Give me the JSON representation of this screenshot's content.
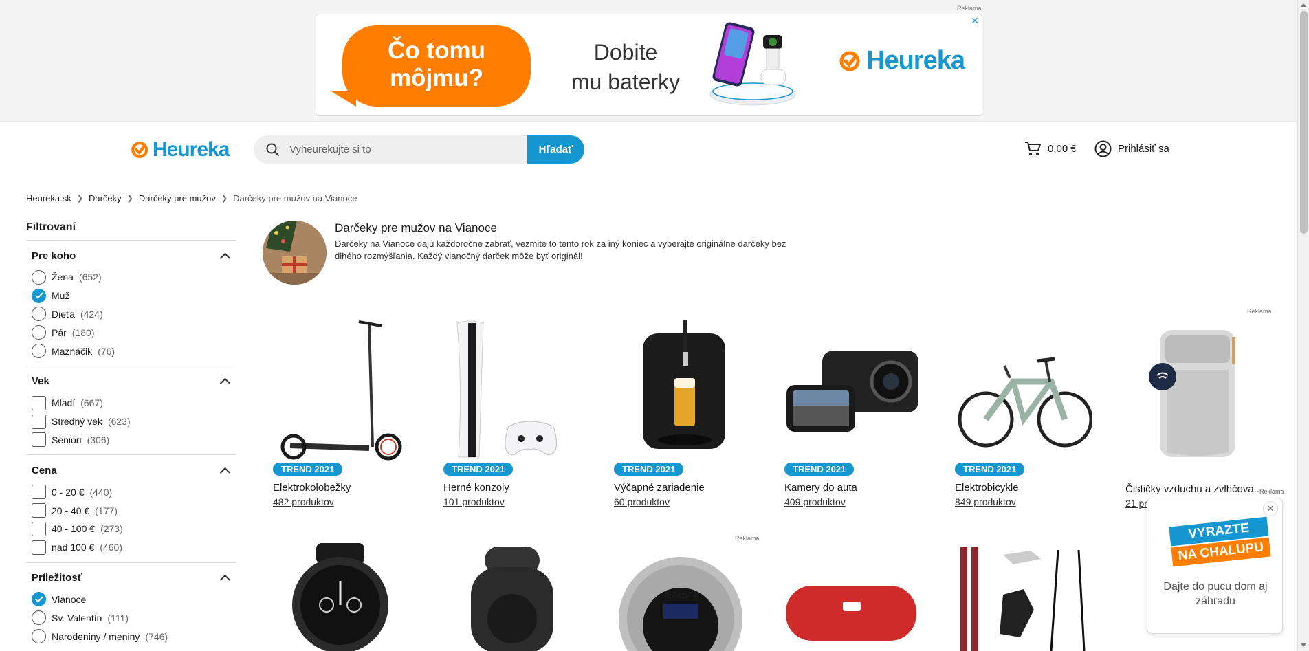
{
  "ad_banner": {
    "label": "Reklama",
    "bubble_line1": "Čo tomu",
    "bubble_line2": "môjmu?",
    "text_line1": "Dobite",
    "text_line2": "mu baterky",
    "brand": "Heureka",
    "close": "✕"
  },
  "header": {
    "logo": "Heureka",
    "search_placeholder": "Vyheurekujte si to",
    "search_button": "Hľadať",
    "cart_amount": "0,00 €",
    "login": "Prihlásiť sa"
  },
  "breadcrumb": [
    "Heureka.sk",
    "Darčeky",
    "Darčeky pre mužov",
    "Darčeky pre mužov na Vianoce"
  ],
  "sidebar": {
    "title": "Filtrovaní",
    "groups": [
      {
        "title": "Pre koho",
        "options": [
          {
            "label": "Žena",
            "count": "(652)",
            "checked": false
          },
          {
            "label": "Muž",
            "count": "",
            "checked": true
          },
          {
            "label": "Dieťa",
            "count": "(424)",
            "checked": false
          },
          {
            "label": "Pár",
            "count": "(180)",
            "checked": false
          },
          {
            "label": "Maznáčik",
            "count": "(76)",
            "checked": false
          }
        ]
      },
      {
        "title": "Vek",
        "options": [
          {
            "label": "Mladí",
            "count": "(667)"
          },
          {
            "label": "Stredný vek",
            "count": "(623)"
          },
          {
            "label": "Seniori",
            "count": "(306)"
          }
        ]
      },
      {
        "title": "Cena",
        "options": [
          {
            "label": "0 - 20 €",
            "count": "(440)"
          },
          {
            "label": "20 - 40 €",
            "count": "(177)"
          },
          {
            "label": "40 - 100 €",
            "count": "(273)"
          },
          {
            "label": "nad 100 €",
            "count": "(460)"
          }
        ]
      },
      {
        "title": "Príležitosť",
        "options": [
          {
            "label": "Vianoce",
            "count": "",
            "checked": true
          },
          {
            "label": "Sv. Valentín",
            "count": "(111)",
            "checked": false
          },
          {
            "label": "Narodeniny / meniny",
            "count": "(746)",
            "checked": false
          }
        ]
      }
    ]
  },
  "intro": {
    "title": "Darčeky pre mužov na Vianoce",
    "description": "Darčeky na Vianoce dajú každoročne zabrať, vezmite to tento rok za iný koniec a vyberajte originálne darčeky bez dlhého rozmýšľania. Každý vianočný darček môže byť originál!"
  },
  "products": [
    {
      "badge": "TREND 2021",
      "name": "Elektrokolobežky",
      "count": "482 produktov"
    },
    {
      "badge": "TREND 2021",
      "name": "Herné konzoly",
      "count": "101 produktov"
    },
    {
      "badge": "TREND 2021",
      "name": "Výčapné zariadenie",
      "count": "60 produktov"
    },
    {
      "badge": "TREND 2021",
      "name": "Kamery do auta",
      "count": "409 produktov"
    },
    {
      "badge": "TREND 2021",
      "name": "Elektrobicykle",
      "count": "849 produktov"
    },
    {
      "badge": "",
      "name": "Čističky vzduchu a zvlhčova...",
      "count": "21 pr",
      "ad": "Reklama"
    }
  ],
  "reklama_labels": {
    "row1": "Reklama",
    "row2": "Reklama",
    "popup": "Reklama"
  },
  "popup": {
    "line1": "VYRAZTE",
    "line2": "NA CHALUPU",
    "text": "Dajte do pucu dom aj záhradu",
    "close": "✕"
  },
  "colors": {
    "brand": "#1797d1",
    "accent": "#ff7d00"
  }
}
